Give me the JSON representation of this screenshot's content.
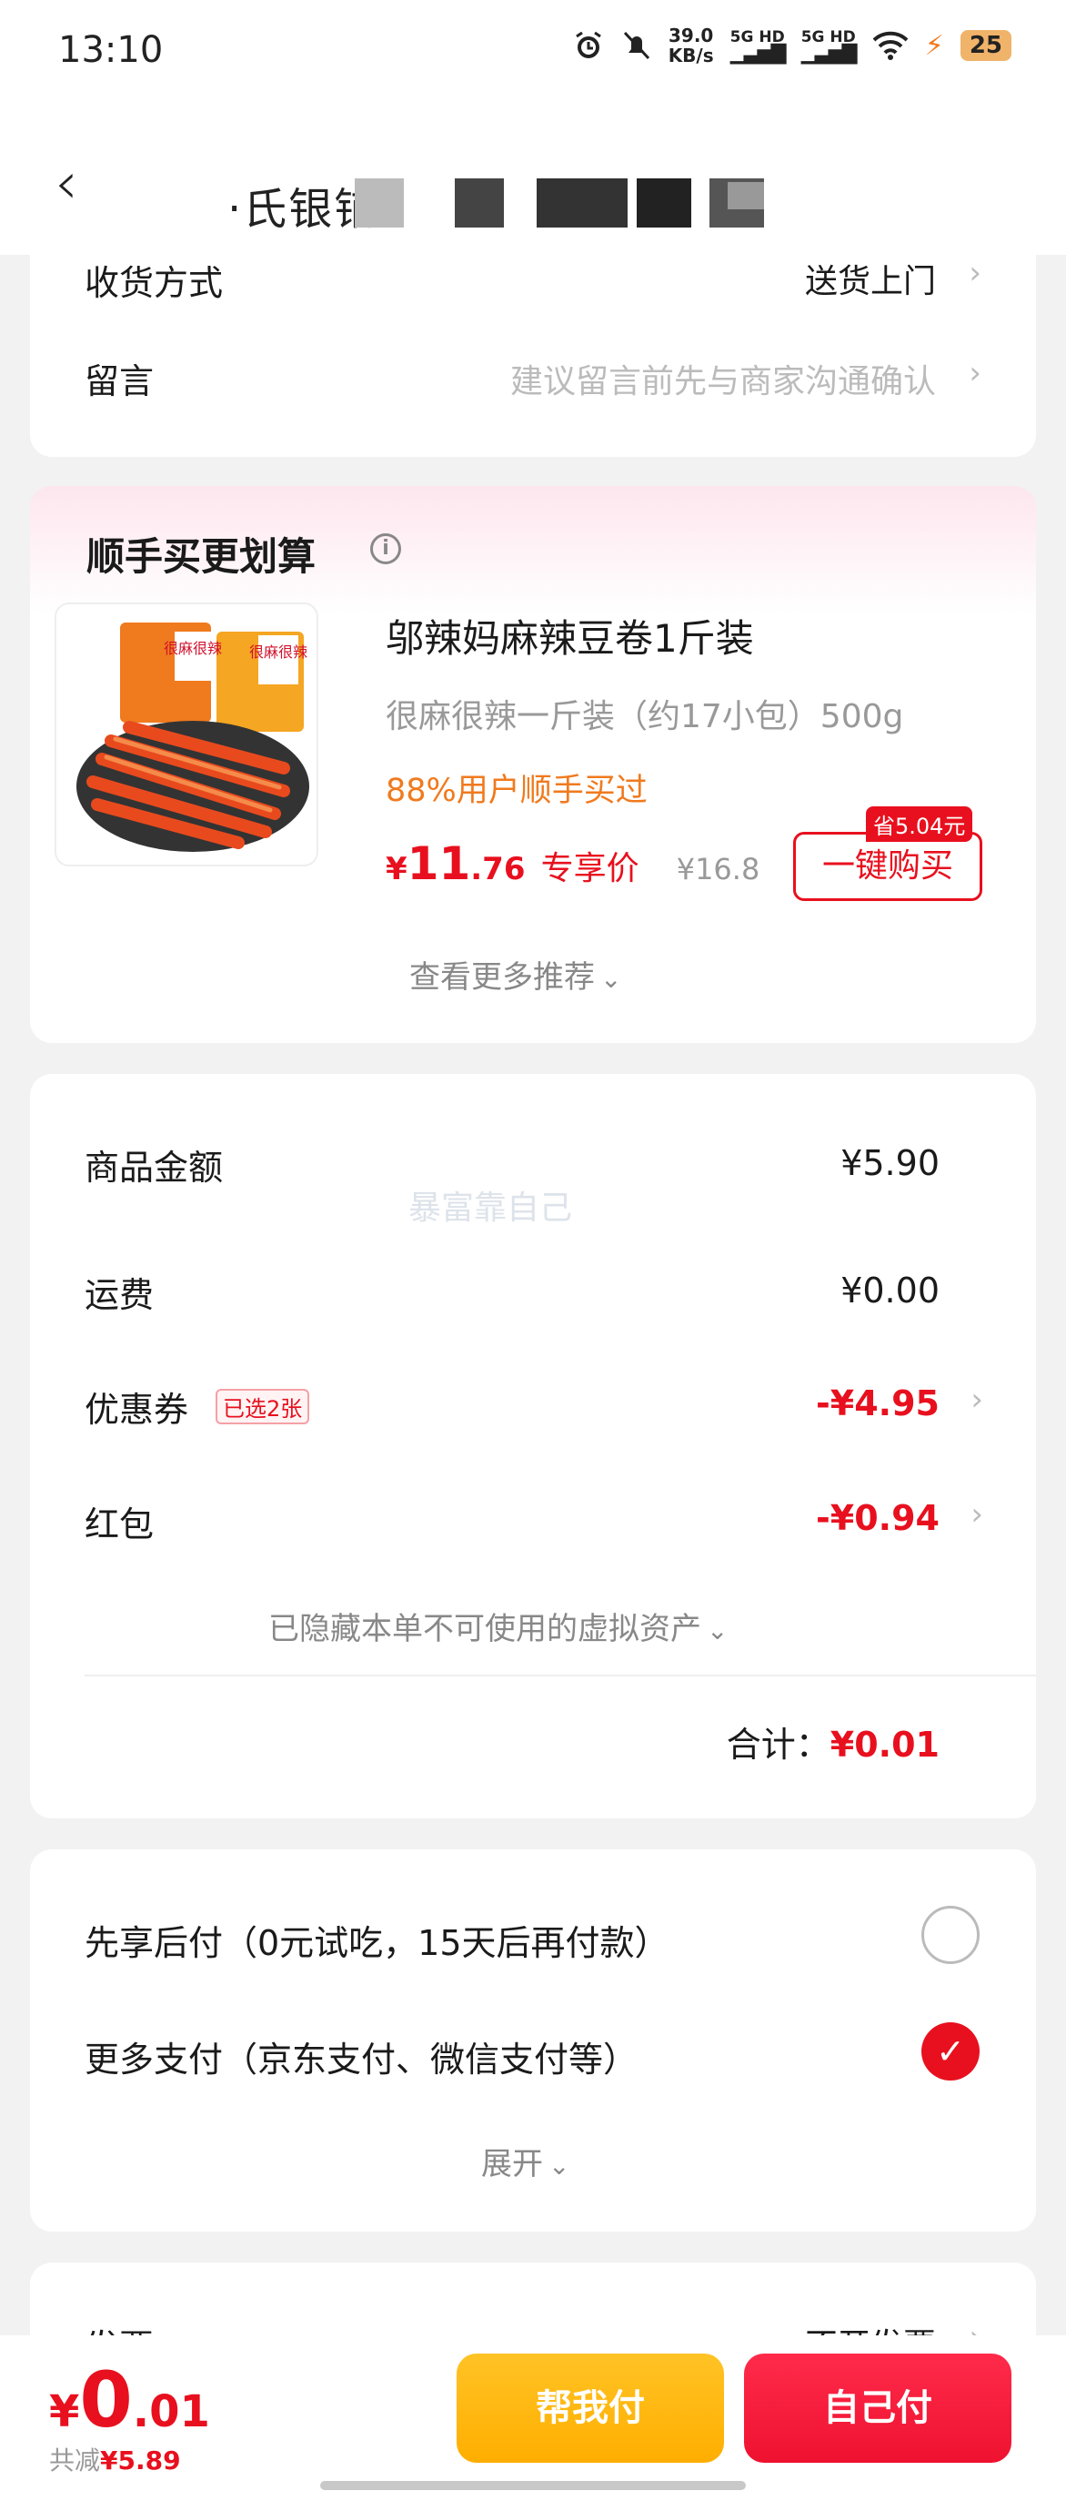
{
  "status_bar": {
    "time": "13:10",
    "net_speed_value": "39.0",
    "net_speed_unit": "KB/s",
    "signal_1": "5G HD",
    "signal_2": "5G HD",
    "battery": "25",
    "icons": [
      "alarm-icon",
      "mute-icon",
      "wifi-icon",
      "charging-icon"
    ]
  },
  "header": {
    "title": "·氏银铺"
  },
  "order_options": {
    "delivery_label": "收货方式",
    "delivery_value": "送货上门",
    "message_label": "留言",
    "message_placeholder": "建议留言前先与商家沟通确认"
  },
  "recommend": {
    "title": "顺手买更划算",
    "product_name": "邬辣妈麻辣豆卷1斤装",
    "product_desc": "很麻很辣一斤装（约17小包）500g",
    "social_proof": "88%用户顺手买过",
    "price_symbol": "¥",
    "price_int": "11",
    "price_dec": ".76",
    "price_tag": "专享价",
    "original_price": "¥16.8",
    "save_badge": "省5.04元",
    "buy_button": "一键购买",
    "more_link": "查看更多推荐",
    "img_label_1": "很麻很辣",
    "img_label_2": "很麻很辣"
  },
  "summary": {
    "goods_label": "商品金额",
    "goods_value": "¥5.90",
    "shipping_label": "运费",
    "shipping_value": "¥0.00",
    "coupon_label": "优惠券",
    "coupon_tag": "已选2张",
    "coupon_value": "-¥4.95",
    "redpacket_label": "红包",
    "redpacket_value": "-¥0.94",
    "hidden_assets": "已隐藏本单不可使用的虚拟资产",
    "total_label": "合计：",
    "total_value": "¥0.01",
    "watermark": "暴富靠自己"
  },
  "payment": {
    "option_later": "先享后付（0元试吃，15天后再付款）",
    "option_more": "更多支付（京东支付、微信支付等）",
    "expand": "展开",
    "selected": "option_more"
  },
  "invoice": {
    "label": "发票",
    "value": "不开发票"
  },
  "bottom_bar": {
    "price_symbol": "¥",
    "price_int": "0",
    "price_dec": ".01",
    "saved_label": "共减",
    "saved_value": "¥5.89",
    "help_pay": "帮我付",
    "self_pay": "自己付"
  },
  "colors": {
    "accent_red": "#e8101e",
    "orange_text": "#f07a1e",
    "help_button": "#ffb400"
  }
}
